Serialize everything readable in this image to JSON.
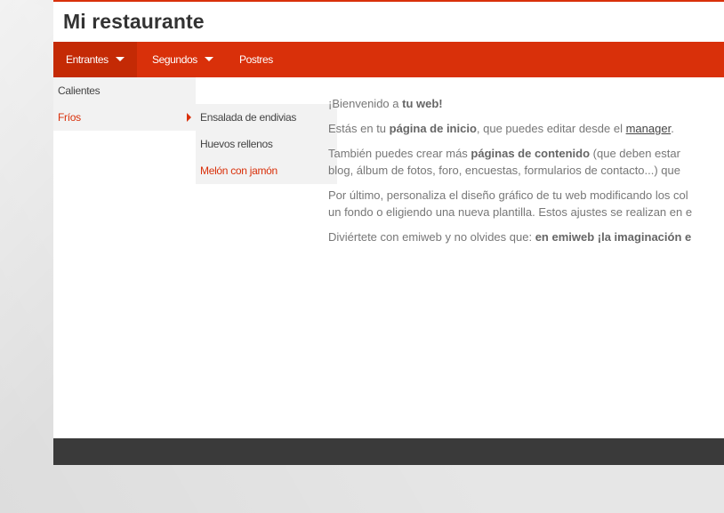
{
  "site": {
    "title": "Mi restaurante"
  },
  "nav": {
    "items": [
      {
        "label": "Entrantes"
      },
      {
        "label": "Segundos"
      },
      {
        "label": "Postres"
      }
    ]
  },
  "dropdown": {
    "items": [
      {
        "label": "Calientes"
      },
      {
        "label": "Fríos"
      }
    ],
    "submenu": [
      {
        "label": "Ensalada de endivias"
      },
      {
        "label": "Huevos rellenos"
      },
      {
        "label": "Melón con jamón"
      }
    ]
  },
  "content": {
    "p1_a": "¡Bienvenido a ",
    "p1_b": "tu web!",
    "p2_a": "Estás en tu ",
    "p2_b": "página de inicio",
    "p2_c": ", que puedes editar desde el ",
    "p2_link": "manager",
    "p2_d": ".",
    "p3_a": "También puedes crear más ",
    "p3_b": "páginas de contenido",
    "p3_c": " (que deben estar",
    "p3_line2": "blog, álbum de fotos, foro, encuestas, formularios de contacto...) que",
    "p4_line1": "Por último, personaliza el diseño gráfico de tu web modificando los col",
    "p4_line2": "un fondo o eligiendo una nueva plantilla. Estos ajustes se realizan en e",
    "p5_a": "Diviértete con emiweb y no olvides que: ",
    "p5_b": "en emiweb ¡la imaginación e"
  },
  "colors": {
    "accent": "#d9300a",
    "footer": "#3a3a3a"
  }
}
